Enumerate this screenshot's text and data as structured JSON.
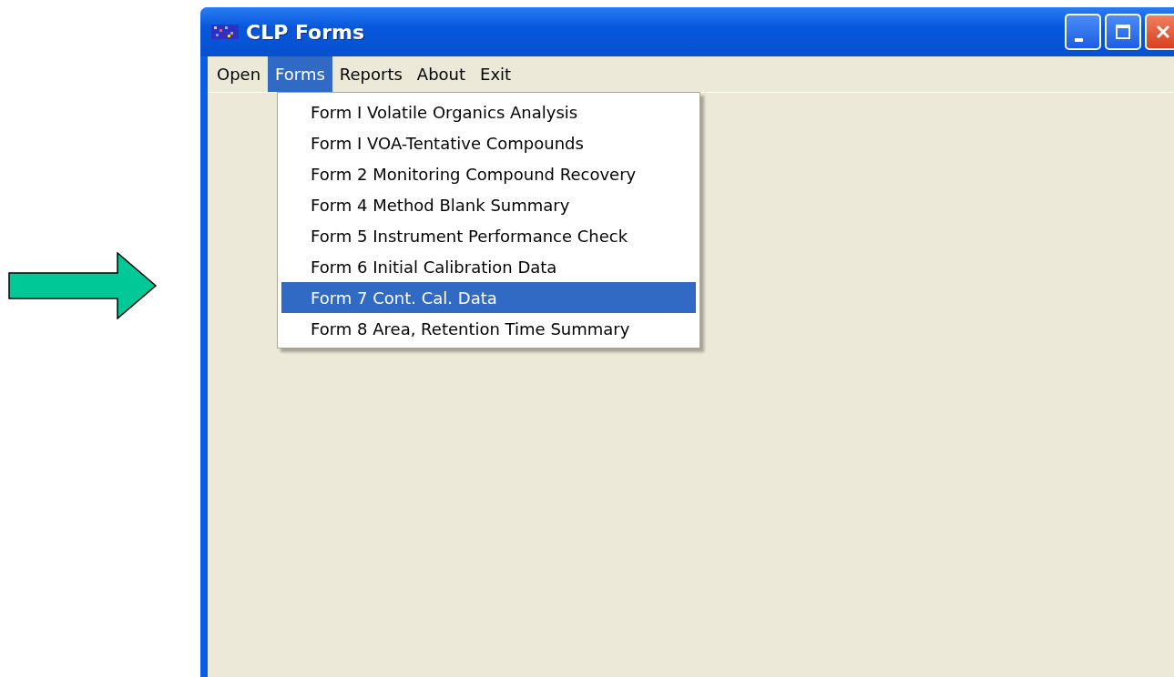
{
  "window": {
    "title": "CLP Forms"
  },
  "menu_bar": [
    {
      "label": "Open",
      "selected": false
    },
    {
      "label": "Forms",
      "selected": true
    },
    {
      "label": "Reports",
      "selected": false
    },
    {
      "label": "About",
      "selected": false
    },
    {
      "label": "Exit",
      "selected": false
    }
  ],
  "dropdown_menu": [
    {
      "label": "Form I Volatile Organics Analysis",
      "selected": false
    },
    {
      "label": "Form I VOA-Tentative Compounds",
      "selected": false
    },
    {
      "label": "Form 2 Monitoring Compound Recovery",
      "selected": false
    },
    {
      "label": "Form 4 Method Blank Summary",
      "selected": false
    },
    {
      "label": "Form 5 Instrument Performance Check",
      "selected": false
    },
    {
      "label": "Form 6 Initial Calibration Data",
      "selected": false
    },
    {
      "label": "Form 7 Cont. Cal. Data",
      "selected": true
    },
    {
      "label": "Form 8 Area, Retention Time Summary",
      "selected": false
    }
  ]
}
